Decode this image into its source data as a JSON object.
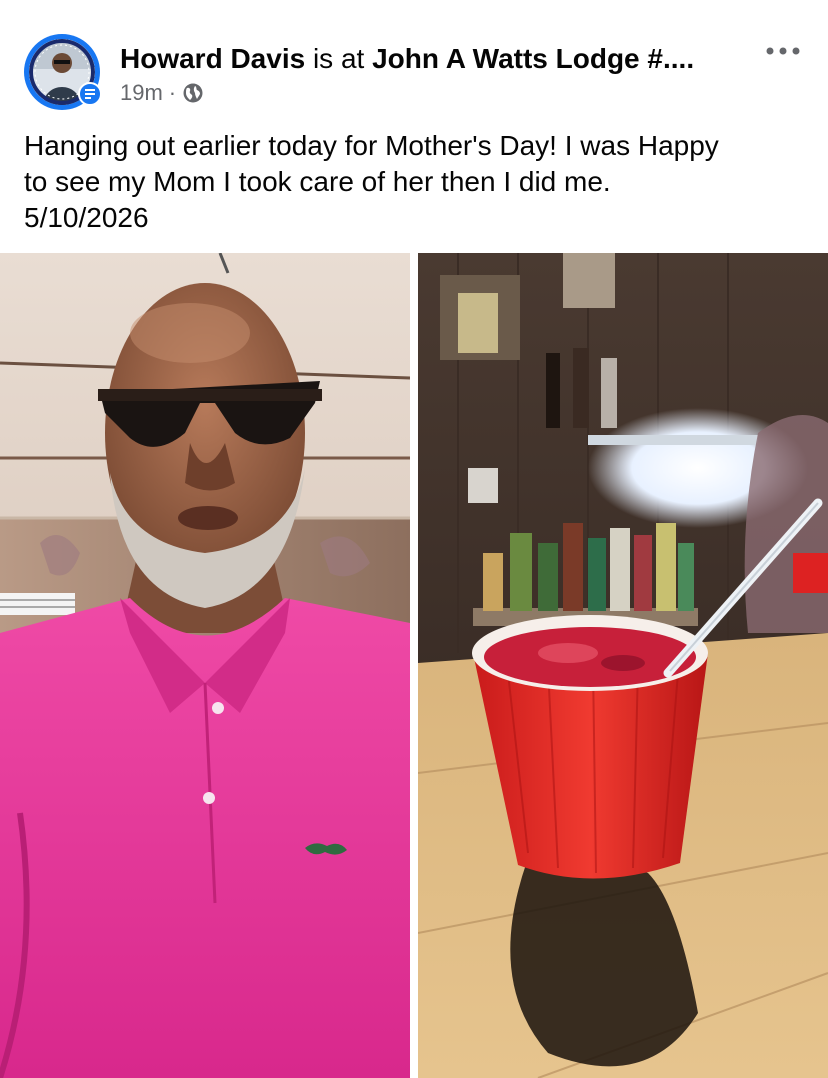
{
  "post": {
    "author": {
      "name": "Howard Davis",
      "avatar_icon": "profile-avatar"
    },
    "header": {
      "connector": " is at ",
      "place": "John A Watts Lodge #...."
    },
    "meta": {
      "time": "19m",
      "separator": "·",
      "privacy_icon": "globe-icon"
    },
    "more_icon": "more-options-icon",
    "caption": {
      "line1": "Hanging out earlier today for Mother's Day! I was Happy",
      "line2": "to see my Mom I took care of her then I did me.",
      "line3": "5/10/2026"
    },
    "photos": [
      {
        "icon": "selfie-photo"
      },
      {
        "icon": "drink-photo"
      }
    ]
  },
  "colors": {
    "brand_blue": "#1877f2",
    "text_primary": "#050505",
    "text_secondary": "#65676b",
    "shirt_pink": "#e8389a",
    "drink_red": "#d42a2a"
  }
}
